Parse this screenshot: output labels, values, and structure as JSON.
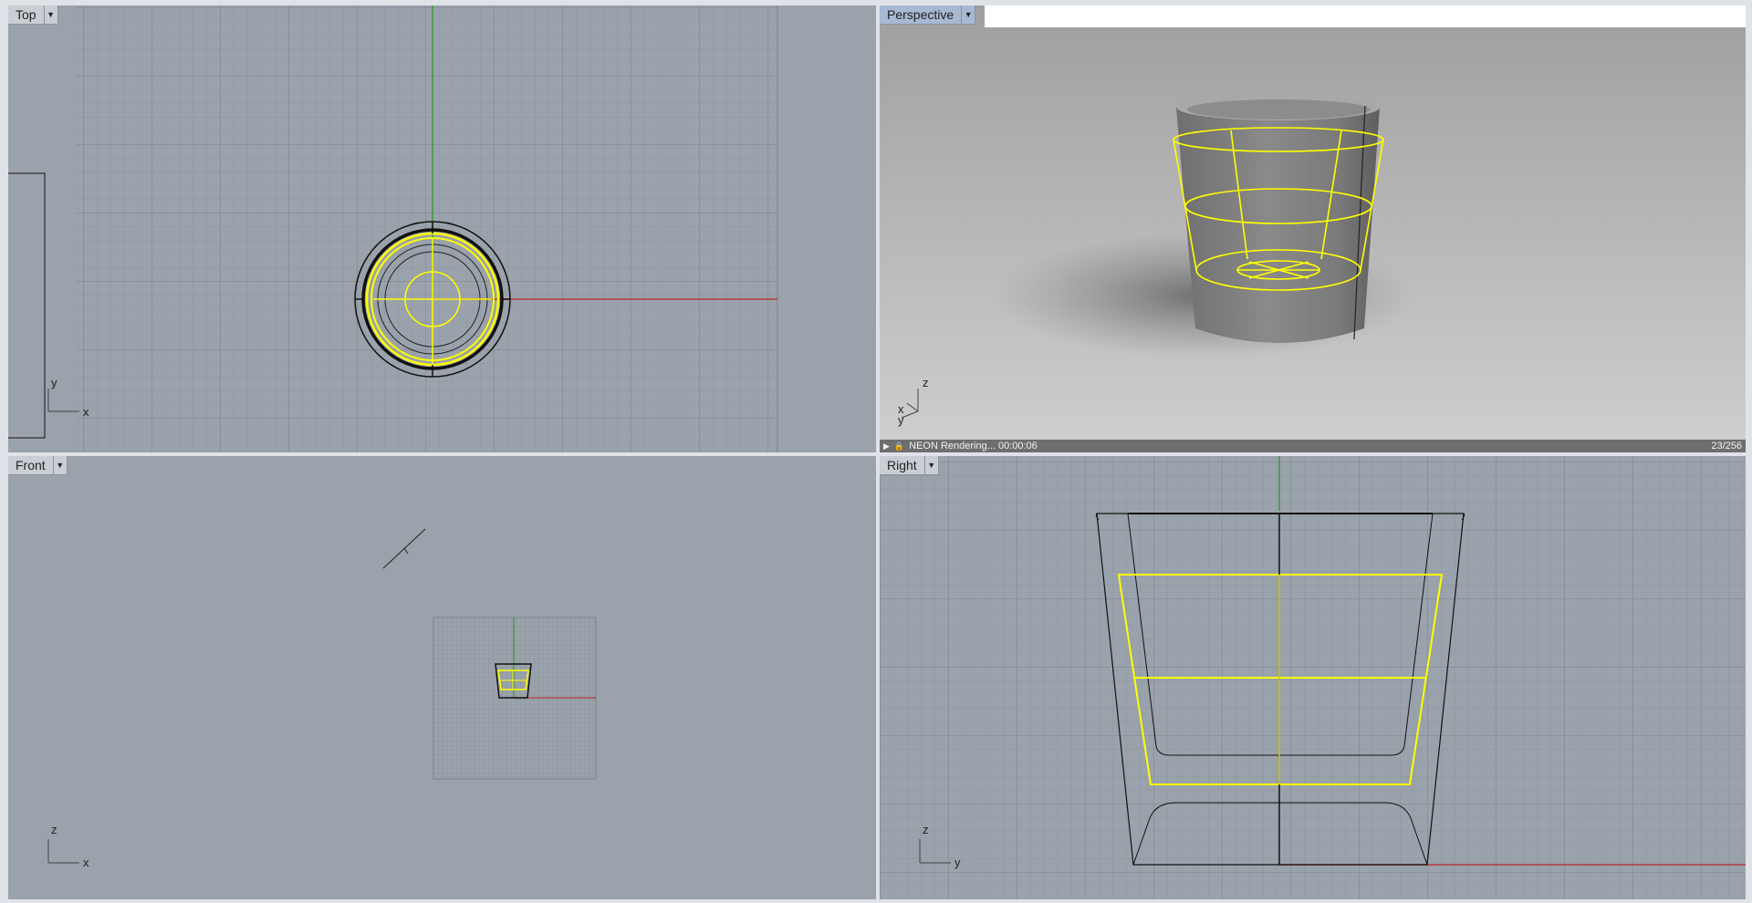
{
  "viewports": {
    "top": {
      "label": "Top",
      "axis_h": "x",
      "axis_v": "y"
    },
    "perspective": {
      "label": "Perspective",
      "axis_labels": {
        "z": "z",
        "x": "x",
        "y": "y"
      },
      "status": {
        "text": "NEON Rendering... 00:00:06",
        "passes": "23/256"
      }
    },
    "front": {
      "label": "Front",
      "axis_h": "x",
      "axis_v": "z"
    },
    "right": {
      "label": "Right",
      "axis_h": "y",
      "axis_v": "z"
    }
  },
  "icons": {
    "dropdown": "chevron-down-icon",
    "play": "play-icon",
    "lock": "lock-icon"
  },
  "colors": {
    "viewport_bg": "#9aa2ab",
    "grid_minor": "#8c949d",
    "grid_major": "#7d858e",
    "selection": "#ffff00",
    "x_axis": "#b33b3b",
    "y_axis": "#3b9b3b",
    "active_tab": "#a7b9d3"
  }
}
